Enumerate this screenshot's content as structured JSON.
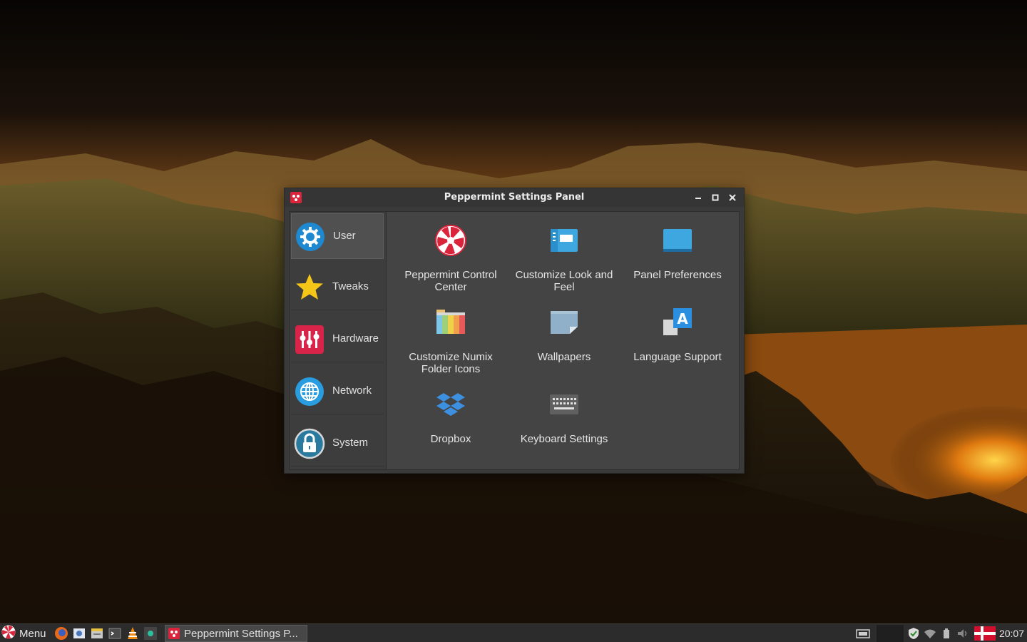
{
  "window": {
    "title": "Peppermint Settings Panel",
    "minimize_label": "minimize",
    "maximize_label": "maximize",
    "close_label": "close"
  },
  "sidebar": {
    "items": [
      {
        "label": "User",
        "icon": "gear-icon",
        "active": true
      },
      {
        "label": "Tweaks",
        "icon": "star-icon",
        "active": false
      },
      {
        "label": "Hardware",
        "icon": "hardware-icon",
        "active": false
      },
      {
        "label": "Network",
        "icon": "globe-icon",
        "active": false
      },
      {
        "label": "System",
        "icon": "lock-icon",
        "active": false
      }
    ]
  },
  "launchers": [
    {
      "label": "Peppermint Control Center",
      "icon": "peppermint-icon"
    },
    {
      "label": "Customize Look and Feel",
      "icon": "window-appearance-icon"
    },
    {
      "label": "Panel Preferences",
      "icon": "panel-icon"
    },
    {
      "label": "Customize Numix Folder Icons",
      "icon": "folder-colors-icon"
    },
    {
      "label": "Wallpapers",
      "icon": "wallpaper-icon"
    },
    {
      "label": "Language Support",
      "icon": "language-icon"
    },
    {
      "label": "Dropbox",
      "icon": "dropbox-icon"
    },
    {
      "label": "Keyboard Settings",
      "icon": "keyboard-icon"
    }
  ],
  "taskbar": {
    "menu_label": "Menu",
    "task_label": "Peppermint Settings P...",
    "clock": "20:07",
    "launcher_icons": [
      "firefox-icon",
      "mail-icon",
      "files-icon",
      "terminal-icon",
      "vlc-icon",
      "screen-icon"
    ],
    "tray_icons": [
      "keyboard-layout-icon",
      "blank-indicator-icon",
      "shield-icon",
      "wifi-icon",
      "battery-icon",
      "volume-icon",
      "danish-flag-icon"
    ]
  },
  "colors": {
    "window_bg": "#3a3a3a",
    "content_bg": "#444444",
    "accent_blue": "#3fa7e0",
    "peppermint_red": "#d9243b"
  }
}
